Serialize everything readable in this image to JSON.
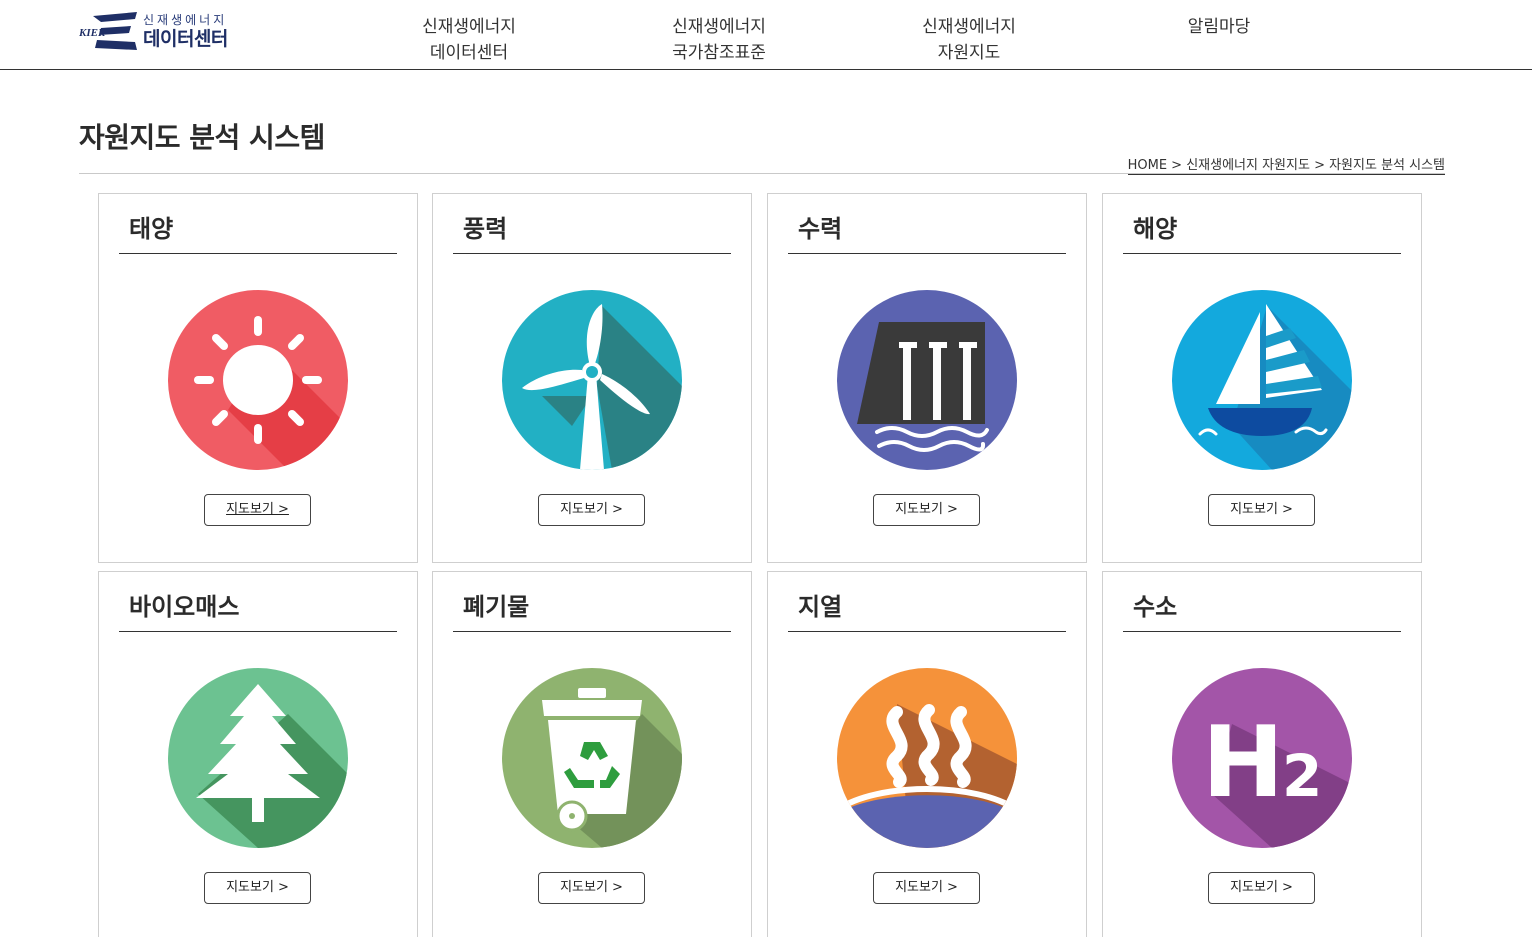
{
  "header": {
    "logo": {
      "mark_text": "KIER",
      "sub": "신재생에너지",
      "main": "데이터센터"
    },
    "nav": [
      {
        "line1": "신재생에너지",
        "line2": "데이터센터"
      },
      {
        "line1": "신재생에너지",
        "line2": "국가참조표준"
      },
      {
        "line1": "신재생에너지",
        "line2": "자원지도"
      },
      {
        "line1": "알림마당",
        "line2": ""
      }
    ]
  },
  "page": {
    "title": "자원지도 분석 시스템",
    "breadcrumb": "HOME > 신재생에너지 자원지도 > 자원지도 분석 시스템"
  },
  "cards": [
    {
      "title": "태양",
      "icon": "sun-icon",
      "button": "지도보기 >",
      "color": "#f0555d"
    },
    {
      "title": "풍력",
      "icon": "wind-turbine-icon",
      "button": "지도보기 >",
      "color": "#22afc3"
    },
    {
      "title": "수력",
      "icon": "hydro-dam-icon",
      "button": "지도보기 >",
      "color": "#5b63b0"
    },
    {
      "title": "해양",
      "icon": "sailboat-icon",
      "button": "지도보기 >",
      "color": "#13a8dc"
    },
    {
      "title": "바이오매스",
      "icon": "tree-icon",
      "button": "지도보기 >",
      "color": "#6cc291"
    },
    {
      "title": "폐기물",
      "icon": "recycle-bin-icon",
      "button": "지도보기 >",
      "color": "#8fb36f"
    },
    {
      "title": "지열",
      "icon": "geothermal-icon",
      "button": "지도보기 >",
      "color": "#f5923a"
    },
    {
      "title": "수소",
      "icon": "hydrogen-icon",
      "button": "지도보기 >",
      "color": "#9b4fa3",
      "icon_text": "H",
      "icon_sub": "2"
    }
  ]
}
